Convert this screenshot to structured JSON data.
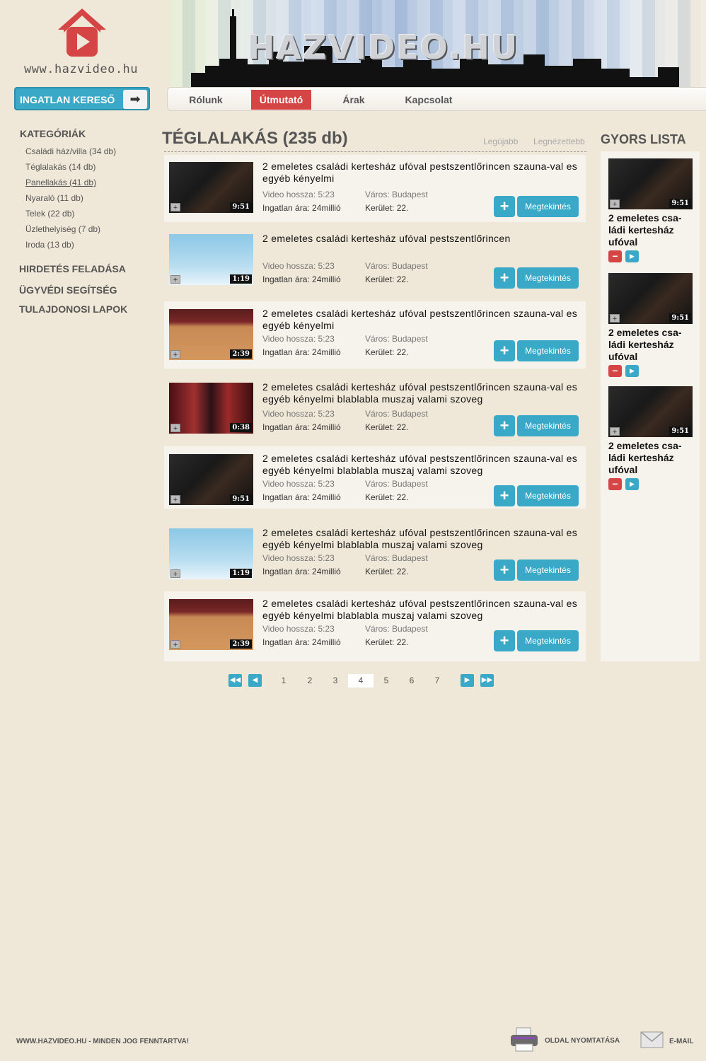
{
  "site": {
    "logo_text": "www.hazvideo.hu",
    "banner_title": "HAZVIDEO.HU"
  },
  "search": {
    "label": "INGATLAN KERESŐ",
    "arrow": "➡"
  },
  "nav": [
    "Rólunk",
    "Útmutató",
    "Árak",
    "Kapcsolat"
  ],
  "nav_active": "Útmutató",
  "sidebar": {
    "title": "KATEGÓRIÁK",
    "categories": [
      "Családi ház/villa (34 db)",
      "Téglalakás (14 db)",
      "Panellakás (41 db)",
      "Nyaraló (11 db)",
      "Telek (22 db)",
      "Üzlethelyiség (7 db)",
      "Iroda (13 db)"
    ],
    "current": "Panellakás (41 db)",
    "links": [
      "HIRDETÉS FELADÁSA",
      "ÜGYVÉDI SEGÍTSÉG",
      "TULAJDONOSI LAPOK"
    ]
  },
  "main": {
    "title": "TÉGLALAKÁS (235 db)",
    "sort": [
      "Legújabb",
      "Legnézettebb"
    ],
    "labels": {
      "length": "Video hossza: 5:23",
      "city": "Város: Budapest",
      "price": "Ingatlan ára: 24millió",
      "district": "Kerület: 22.",
      "plus": "+",
      "view": "Megtekintés"
    },
    "items": [
      {
        "title": "2 emeletes családi kertesház ufóval pestszentlőrincen szauna-val es egyéb kényelmi",
        "duration": "9:51",
        "scene": "dark"
      },
      {
        "title": "2 emeletes családi kertesház ufóval pestszentlőrincen",
        "duration": "1:19",
        "scene": "sky"
      },
      {
        "title": "2 emeletes családi kertesház ufóval pestszentlőrincen szauna-val es egyéb kényelmi",
        "duration": "2:39",
        "scene": "court"
      },
      {
        "title": "2 emeletes családi kertesház ufóval pestszentlőrincen szauna-val es egyéb kényelmi blablabla muszaj valami szoveg",
        "duration": "0:38",
        "scene": "stage"
      },
      {
        "title": "2 emeletes családi kertesház ufóval pestszentlőrincen szauna-val es egyéb kényelmi blablabla muszaj valami szoveg",
        "duration": "9:51",
        "scene": "dark"
      },
      {
        "title": "2 emeletes családi kertesház ufóval pestszentlőrincen szauna-val es egyéb kényelmi blablabla muszaj valami szoveg",
        "duration": "1:19",
        "scene": "sky"
      },
      {
        "title": "2 emeletes családi kertesház ufóval pestszentlőrincen szauna-val es egyéb kényelmi blablabla muszaj valami szoveg",
        "duration": "2:39",
        "scene": "court"
      }
    ]
  },
  "pagination": {
    "pages": [
      "1",
      "2",
      "3",
      "4",
      "5",
      "6",
      "7"
    ],
    "current": "4",
    "first": "◀◀",
    "prev": "◀",
    "next": "▶",
    "last": "▶▶"
  },
  "quick_list": {
    "title": "GYORS LISTA",
    "items": [
      {
        "title": "2 emeletes csa-ládi kertesház ufóval",
        "duration": "9:51"
      },
      {
        "title": "2 emeletes csa-ládi kertesház ufóval",
        "duration": "9:51"
      },
      {
        "title": "2 emeletes csa-ládi kertesház ufóval",
        "duration": "9:51"
      }
    ],
    "remove": "−",
    "play": "▶"
  },
  "footer": {
    "copyright": "WWW.HAZVIDEO.HU - MINDEN JOG FENNTARTVA!",
    "print": "OLDAL NYOMTATÁSA",
    "email": "E-MAIL"
  },
  "colors": {
    "accent": "#3aa9c8",
    "active": "#d64545",
    "background": "#efe7d7"
  },
  "icons": {
    "logo": "house-play-icon",
    "thumb_plus": "plus-icon",
    "printer": "printer-icon",
    "mail": "mail-icon"
  }
}
